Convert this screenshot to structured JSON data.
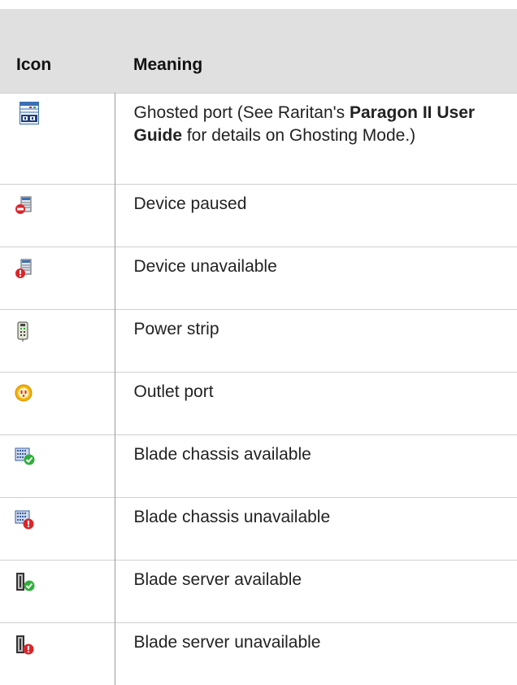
{
  "header": {
    "icon": "Icon",
    "meaning": "Meaning"
  },
  "rows": [
    {
      "icon": "ghosted-port-icon",
      "text_before": "Ghosted port (See Raritan's ",
      "text_bold": "Paragon II User Guide",
      "text_after": " for details on Ghosting Mode.)"
    },
    {
      "icon": "device-paused-icon",
      "text": "Device paused"
    },
    {
      "icon": "device-unavailable-icon",
      "text": "Device unavailable"
    },
    {
      "icon": "power-strip-icon",
      "text": "Power strip"
    },
    {
      "icon": "outlet-port-icon",
      "text": "Outlet port"
    },
    {
      "icon": "blade-chassis-available-icon",
      "text": "Blade chassis available"
    },
    {
      "icon": "blade-chassis-unavailable-icon",
      "text": "Blade chassis unavailable"
    },
    {
      "icon": "blade-server-available-icon",
      "text": "Blade server available"
    },
    {
      "icon": "blade-server-unavailable-icon",
      "text": "Blade server unavailable"
    }
  ],
  "colors": {
    "header_bg": "#e0e0e0",
    "border": "#9a9a9a",
    "ok_green": "#2fae3b",
    "error_red": "#d9262b"
  }
}
